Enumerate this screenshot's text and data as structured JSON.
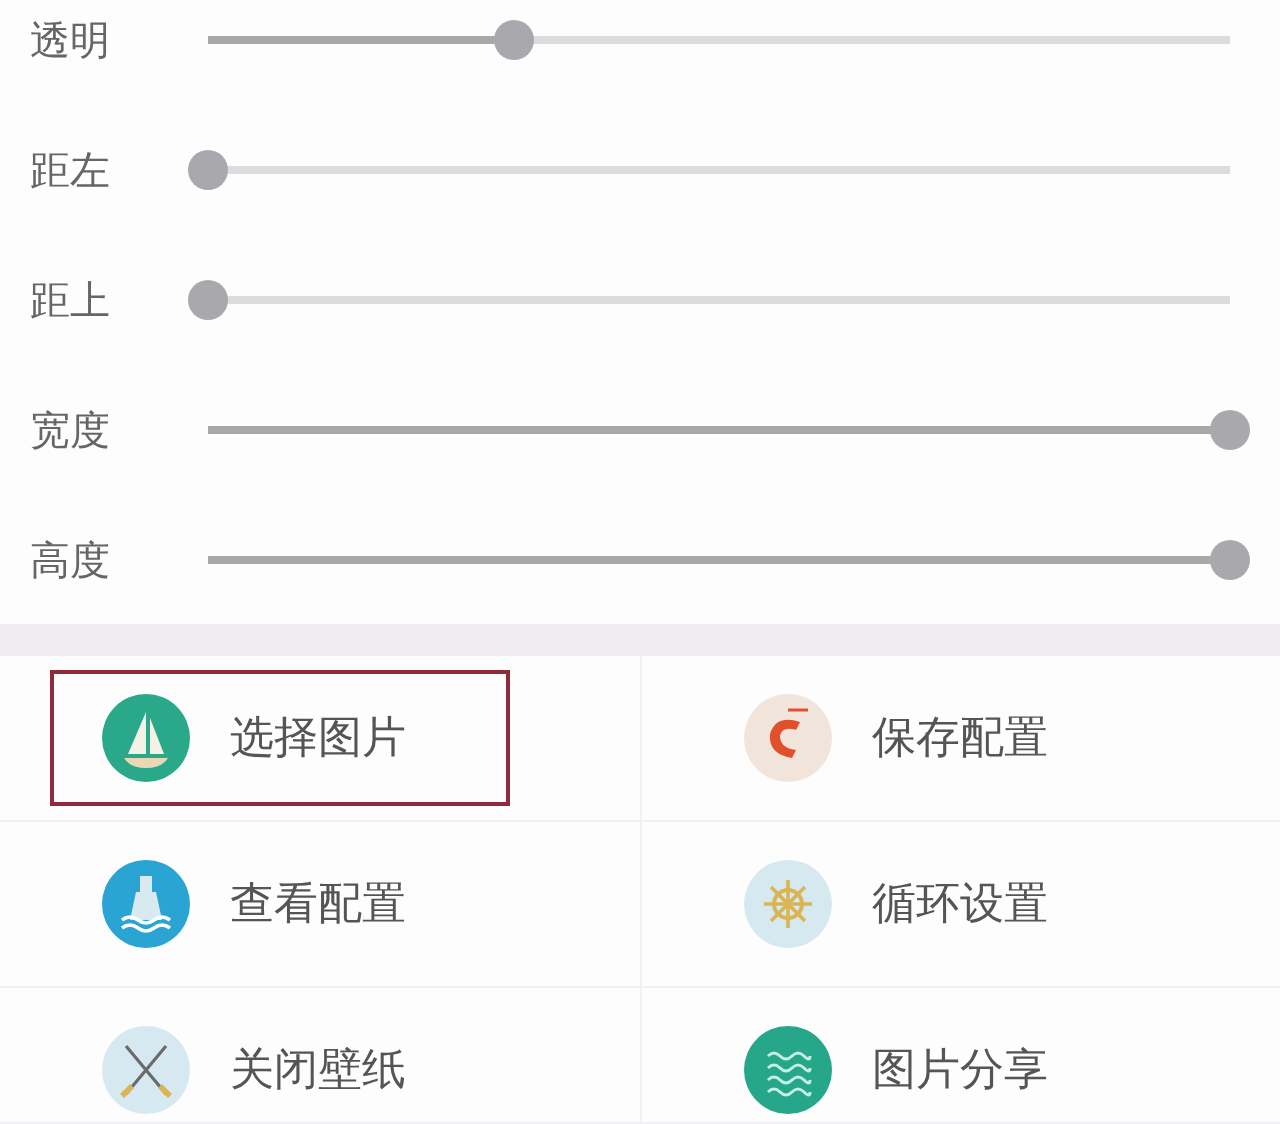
{
  "sliders": [
    {
      "label": "透明",
      "level": 0.3
    },
    {
      "label": "距左",
      "level": 0
    },
    {
      "label": "距上",
      "level": 0
    },
    {
      "label": "宽度",
      "level": 1
    },
    {
      "label": "高度",
      "level": 1
    }
  ],
  "actions": [
    {
      "label": "选择图片",
      "kind": "sailboat",
      "highlighted": true
    },
    {
      "label": "保存配置",
      "kind": "shrimp",
      "highlighted": false
    },
    {
      "label": "查看配置",
      "kind": "bottle",
      "highlighted": false
    },
    {
      "label": "循环设置",
      "kind": "wheel",
      "highlighted": false
    },
    {
      "label": "关闭壁纸",
      "kind": "oars",
      "highlighted": false
    },
    {
      "label": "图片分享",
      "kind": "waves",
      "highlighted": false
    }
  ]
}
